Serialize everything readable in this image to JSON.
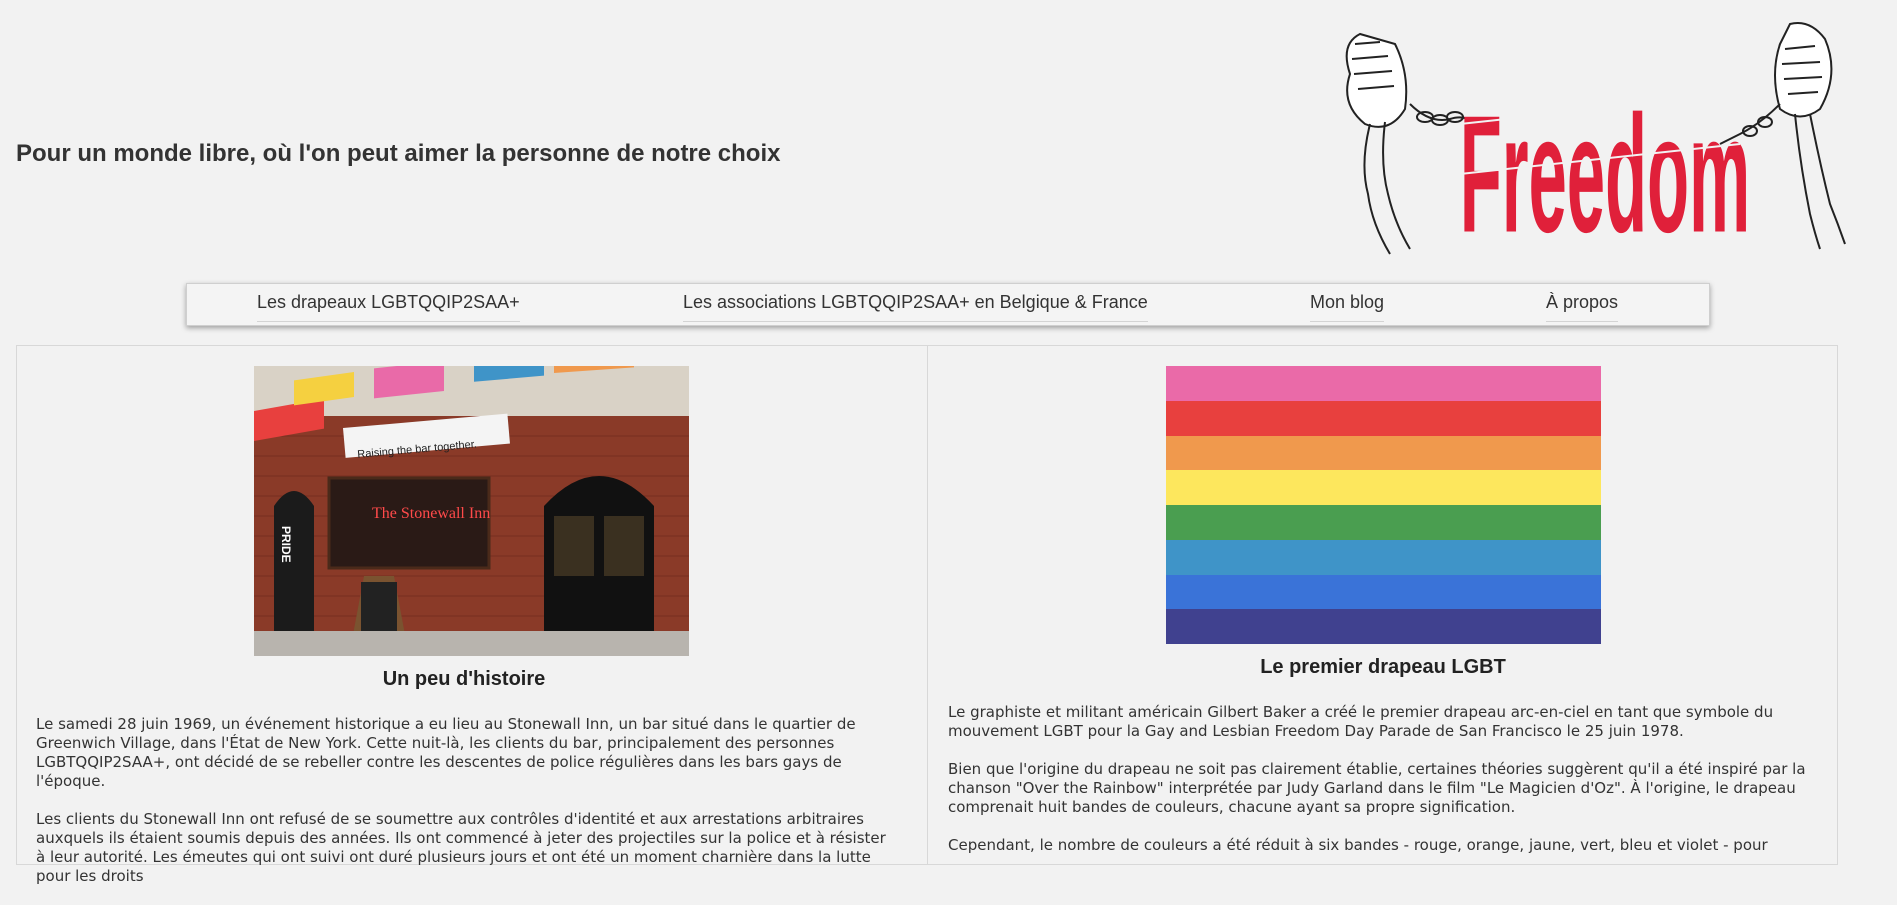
{
  "header": {
    "tagline": "Pour un monde libre, où l'on peut aimer la personne de notre choix",
    "logo_text": "Freedom",
    "logo_icon": "broken-chain-fist-icon"
  },
  "nav": {
    "items": [
      {
        "label": "Les drapeaux LGBTQQIP2SAA+"
      },
      {
        "label": "Les associations LGBTQQIP2SAA+ en Belgique & France"
      },
      {
        "label": "Mon blog"
      },
      {
        "label": "À propos"
      }
    ]
  },
  "left": {
    "photo_sign_1": "Raising the bar together.",
    "photo_sign_2": "The Stonewall Inn",
    "photo_sign_3": "PRIDE",
    "title": "Un peu d'histoire",
    "paragraphs": [
      "Le samedi 28 juin 1969, un événement historique a eu lieu au Stonewall Inn, un bar situé dans le quartier de Greenwich Village, dans l'État de New York. Cette nuit-là, les clients du bar, principalement des personnes LGBTQQIP2SAA+, ont décidé de se rebeller contre les descentes de police régulières dans les bars gays de l'époque.",
      "Les clients du Stonewall Inn ont refusé de se soumettre aux contrôles d'identité et aux arrestations arbitraires auxquels ils étaient soumis depuis des années. Ils ont commencé à jeter des projectiles sur la police et à résister à leur autorité. Les émeutes qui ont suivi ont duré plusieurs jours et ont été un moment charnière dans la lutte pour les droits"
    ]
  },
  "right": {
    "flag_colors": [
      "#ea6aa8",
      "#e8403e",
      "#f0994d",
      "#fde75d",
      "#4a9e50",
      "#3f94c8",
      "#3a73d8",
      "#40418f"
    ],
    "title": "Le premier drapeau LGBT",
    "paragraphs": [
      "Le graphiste et militant américain Gilbert Baker a créé le premier drapeau arc-en-ciel en tant que symbole du mouvement LGBT pour la Gay and Lesbian Freedom Day Parade de San Francisco le 25 juin 1978.",
      "Bien que l'origine du drapeau ne soit pas clairement établie, certaines théories suggèrent qu'il a été inspiré par la chanson \"Over the Rainbow\" interprétée par Judy Garland dans le film \"Le Magicien d'Oz\". À l'origine, le drapeau comprenait huit bandes de couleurs, chacune ayant sa propre signification.",
      "Cependant, le nombre de couleurs a été réduit à six bandes - rouge, orange, jaune, vert, bleu et violet - pour"
    ]
  },
  "colors": {
    "logo_red": "#e0203a",
    "background": "#f2f2f2"
  }
}
